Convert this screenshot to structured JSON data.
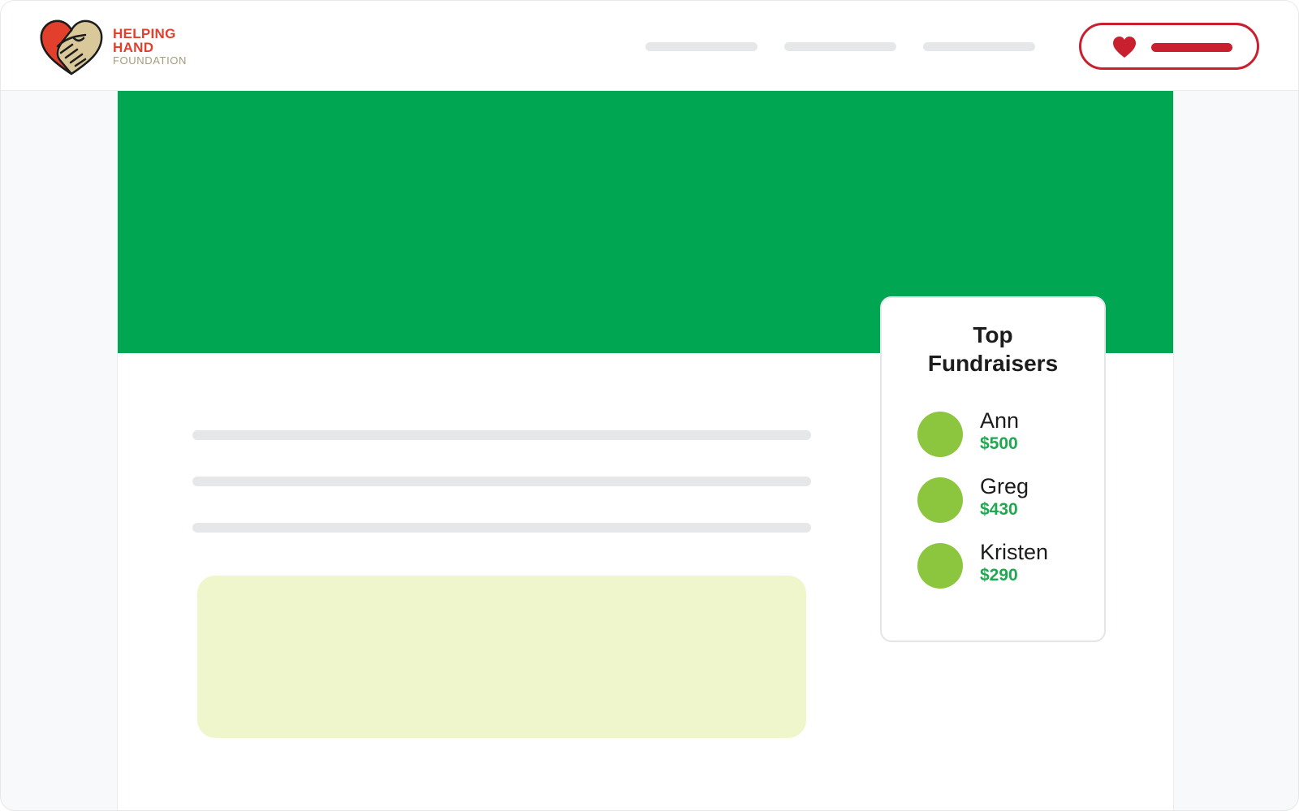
{
  "brand": {
    "line1": "HELPING",
    "line2": "HAND",
    "line3": "FOUNDATION",
    "primary_color": "#e2402d",
    "secondary_color": "#a49b7b",
    "logo_icon": "heart-handshake-icon"
  },
  "donate_button": {
    "icon": "heart-icon",
    "color": "#c8202f"
  },
  "hero": {
    "color": "#00a651"
  },
  "top_fundraisers": {
    "title_line1": "Top",
    "title_line2": "Fundraisers",
    "items": [
      {
        "name": "Ann",
        "amount": "$500"
      },
      {
        "name": "Greg",
        "amount": "$430"
      },
      {
        "name": "Kristen",
        "amount": "$290"
      }
    ],
    "avatar_color": "#8cc63f",
    "amount_color": "#1fa84f"
  }
}
